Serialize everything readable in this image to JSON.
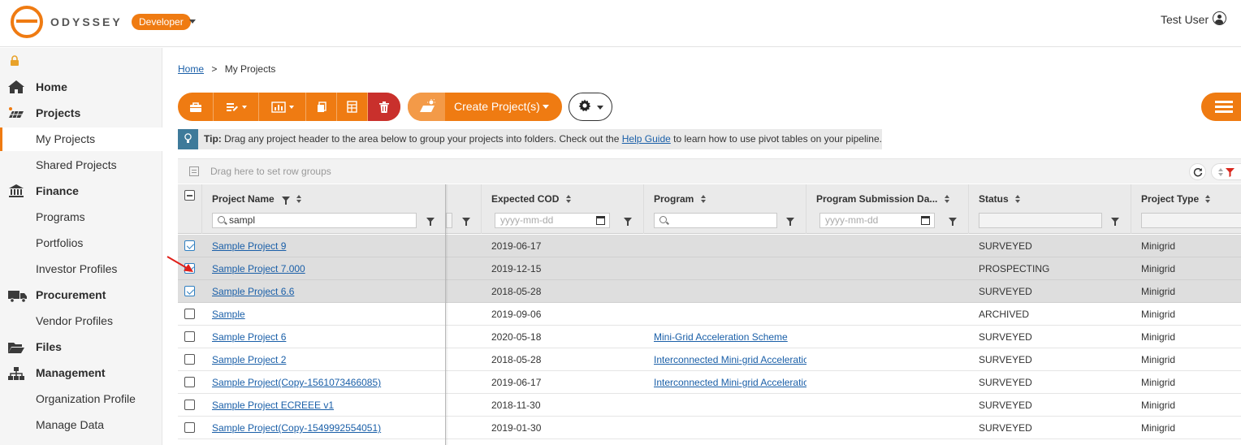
{
  "app": {
    "logo_text": "ODYSSEY",
    "environment": "Developer",
    "user_name": "Test User"
  },
  "sidebar": {
    "home": "Home",
    "projects": "Projects",
    "my_projects": "My Projects",
    "shared_projects": "Shared Projects",
    "finance": "Finance",
    "programs": "Programs",
    "portfolios": "Portfolios",
    "investor_profiles": "Investor Profiles",
    "procurement": "Procurement",
    "vendor_profiles": "Vendor Profiles",
    "files": "Files",
    "management": "Management",
    "organization_profile": "Organization Profile",
    "manage_data": "Manage Data"
  },
  "breadcrumb": {
    "home": "Home",
    "separator": ">",
    "current": "My Projects"
  },
  "toolbar": {
    "create_label": "Create Project(s)"
  },
  "tip": {
    "prefix": "Tip:",
    "text_before": "Drag any project header to the area below to group your projects into folders. Check out the",
    "link": "Help Guide",
    "text_after": "to learn how to use pivot tables on your pipeline."
  },
  "grid": {
    "group_placeholder": "Drag here to set row groups",
    "columns": {
      "project_name": "Project Name",
      "expected_cod": "Expected COD",
      "program": "Program",
      "program_submission": "Program Submission Da...",
      "status": "Status",
      "project_type": "Project Type"
    },
    "filters": {
      "project_name_value": "sampl",
      "date_placeholder": "yyyy-mm-dd"
    },
    "rows": [
      {
        "name": "Sample Project 9",
        "cod": "2019-06-17",
        "program": "",
        "status": "SURVEYED",
        "type": "Minigrid",
        "selected": true
      },
      {
        "name": "Sample Project 7.000",
        "cod": "2019-12-15",
        "program": "",
        "status": "PROSPECTING",
        "type": "Minigrid",
        "selected": true
      },
      {
        "name": "Sample Project 6.6",
        "cod": "2018-05-28",
        "program": "",
        "status": "SURVEYED",
        "type": "Minigrid",
        "selected": true
      },
      {
        "name": "Sample",
        "cod": "2019-09-06",
        "program": "",
        "status": "ARCHIVED",
        "type": "Minigrid",
        "selected": false
      },
      {
        "name": "Sample Project 6",
        "cod": "2020-05-18",
        "program": "Mini-Grid Acceleration Scheme",
        "status": "SURVEYED",
        "type": "Minigrid",
        "selected": false
      },
      {
        "name": "Sample Project 2",
        "cod": "2018-05-28",
        "program": "Interconnected Mini-grid Acceleratic",
        "status": "SURVEYED",
        "type": "Minigrid",
        "selected": false
      },
      {
        "name": "Sample Project(Copy-1561073466085)",
        "cod": "2019-06-17",
        "program": "Interconnected Mini-grid Acceleratic",
        "status": "SURVEYED",
        "type": "Minigrid",
        "selected": false
      },
      {
        "name": "Sample Project ECREEE v1",
        "cod": "2018-11-30",
        "program": "",
        "status": "SURVEYED",
        "type": "Minigrid",
        "selected": false
      },
      {
        "name": "Sample Project(Copy-1549992554051)",
        "cod": "2019-01-30",
        "program": "",
        "status": "SURVEYED",
        "type": "Minigrid",
        "selected": false
      }
    ]
  },
  "colors": {
    "accent": "#ef7b12",
    "danger": "#c9302c",
    "tip_icon": "#3e7a9a",
    "link": "#1a5fa8"
  }
}
